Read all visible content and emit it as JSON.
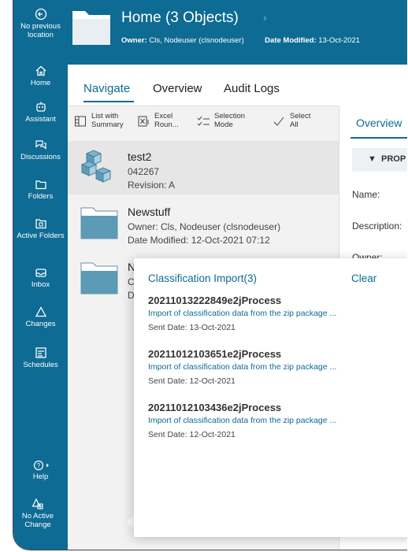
{
  "sidebar": {
    "items": [
      {
        "label": "No previous location",
        "icon": "back-icon"
      },
      {
        "label": "Home",
        "icon": "home-icon"
      },
      {
        "label": "Assistant",
        "icon": "assistant-icon"
      },
      {
        "label": "Discussions",
        "icon": "discussions-icon"
      },
      {
        "label": "Folders",
        "icon": "folder-icon"
      },
      {
        "label": "Active Folders",
        "icon": "active-folders-icon"
      },
      {
        "label": "Inbox",
        "icon": "inbox-icon"
      },
      {
        "label": "Changes",
        "icon": "changes-icon"
      },
      {
        "label": "Schedules",
        "icon": "schedules-icon"
      },
      {
        "label": "Help",
        "icon": "help-icon"
      },
      {
        "label": "No Active Change",
        "icon": "no-active-change-icon"
      }
    ]
  },
  "header": {
    "title": "Home (3 Objects)",
    "owner_label": "Owner:",
    "owner_value": "Cls, Nodeuser (clsnodeuser)",
    "date_label": "Date Modified:",
    "date_value": "13-Oct-2021"
  },
  "tabs": [
    {
      "label": "Navigate",
      "active": true
    },
    {
      "label": "Overview",
      "active": false
    },
    {
      "label": "Audit Logs",
      "active": false
    }
  ],
  "toolbar": {
    "list_summary": "List with Summary",
    "excel": "Excel Roun...",
    "selection_mode": "Selection Mode",
    "select_all": "Select All"
  },
  "list": [
    {
      "name": "test2",
      "line1": "042267",
      "line2": "Revision:  A",
      "icon": "item-cubes-icon"
    },
    {
      "name": "Newstuff",
      "line1": "Owner:  Cls, Nodeuser (clsnodeuser)",
      "line2": "Date Modified:  12-Oct-2021 07:12",
      "icon": "folder-icon"
    },
    {
      "name": "N",
      "line1": "C",
      "line2": "D",
      "icon": "folder-icon"
    }
  ],
  "right_panel": {
    "tab": "Overview",
    "section": "PROP",
    "fields": [
      "Name:",
      "Description:",
      "Owner:"
    ]
  },
  "popup": {
    "title": "Classification Import(3)",
    "clear": "Clear",
    "notifications": [
      {
        "title": "20211013222849e2jProcess",
        "description": "Import of classification data from the zip package ...",
        "date": "Sent Date: 13-Oct-2021"
      },
      {
        "title": "20211012103651e2jProcess",
        "description": "Import of classification data from the zip package ...",
        "date": "Sent Date: 12-Oct-2021"
      },
      {
        "title": "20211012103436e2jProcess",
        "description": "Import of classification data from the zip package ...",
        "date": "Sent Date: 12-Oct-2021"
      }
    ]
  },
  "colors": {
    "brand": "#0e6b94",
    "list_bg": "#f2f2f2",
    "folder_fill": "#5b9bb5"
  }
}
